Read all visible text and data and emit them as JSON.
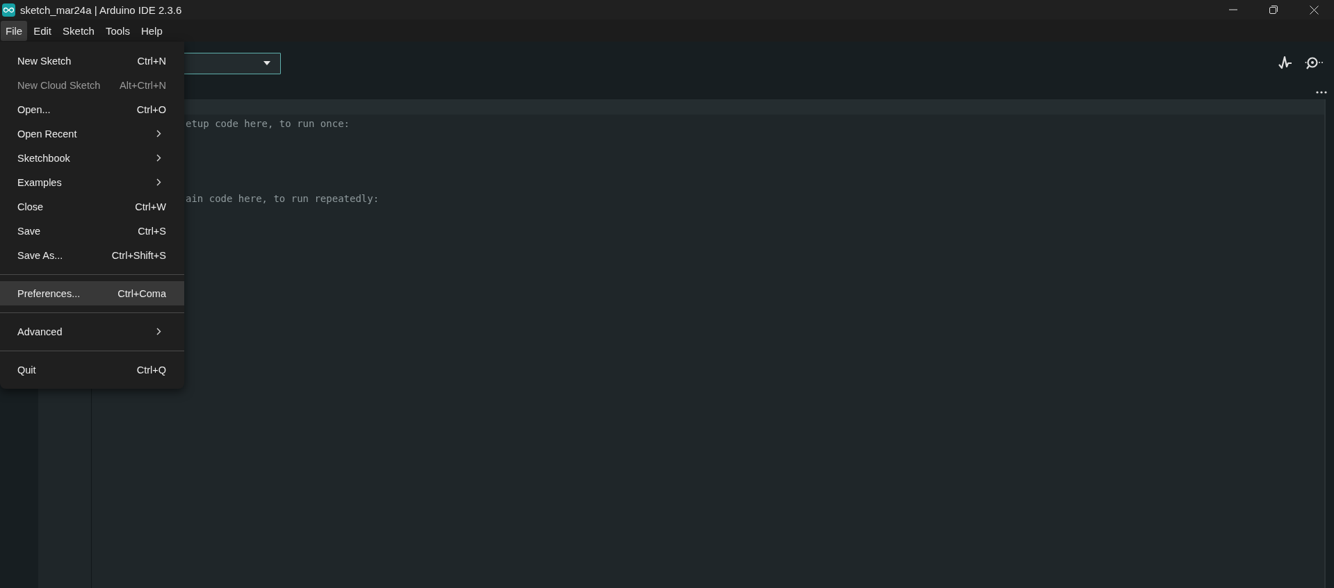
{
  "window": {
    "title": "sketch_mar24a | Arduino IDE 2.3.6"
  },
  "menu_bar": [
    {
      "label": "File",
      "selected": true
    },
    {
      "label": "Edit",
      "selected": false
    },
    {
      "label": "Sketch",
      "selected": false
    },
    {
      "label": "Tools",
      "selected": false
    },
    {
      "label": "Help",
      "selected": false
    }
  ],
  "file_menu": [
    {
      "kind": "item",
      "label": "New Sketch",
      "shortcut": "Ctrl+N",
      "disabled": false,
      "selected": false
    },
    {
      "kind": "item",
      "label": "New Cloud Sketch",
      "shortcut": "Alt+Ctrl+N",
      "disabled": true,
      "selected": false
    },
    {
      "kind": "item",
      "label": "Open...",
      "shortcut": "Ctrl+O",
      "disabled": false,
      "selected": false
    },
    {
      "kind": "submenu",
      "label": "Open Recent",
      "disabled": false,
      "selected": false
    },
    {
      "kind": "submenu",
      "label": "Sketchbook",
      "disabled": false,
      "selected": false
    },
    {
      "kind": "submenu",
      "label": "Examples",
      "disabled": false,
      "selected": false
    },
    {
      "kind": "item",
      "label": "Close",
      "shortcut": "Ctrl+W",
      "disabled": false,
      "selected": false
    },
    {
      "kind": "item",
      "label": "Save",
      "shortcut": "Ctrl+S",
      "disabled": false,
      "selected": false
    },
    {
      "kind": "item",
      "label": "Save As...",
      "shortcut": "Ctrl+Shift+S",
      "disabled": false,
      "selected": false
    },
    {
      "kind": "separator"
    },
    {
      "kind": "item",
      "label": "Preferences...",
      "shortcut": "Ctrl+Coma",
      "disabled": false,
      "selected": true
    },
    {
      "kind": "separator"
    },
    {
      "kind": "submenu",
      "label": "Advanced",
      "disabled": false,
      "selected": false
    },
    {
      "kind": "separator"
    },
    {
      "kind": "item",
      "label": "Quit",
      "shortcut": "Ctrl+Q",
      "disabled": false,
      "selected": false
    }
  ],
  "code_lines": [
    {
      "text": "etup code here, to run once:"
    },
    {
      "text": "ain code here, to run repeatedly:"
    }
  ]
}
